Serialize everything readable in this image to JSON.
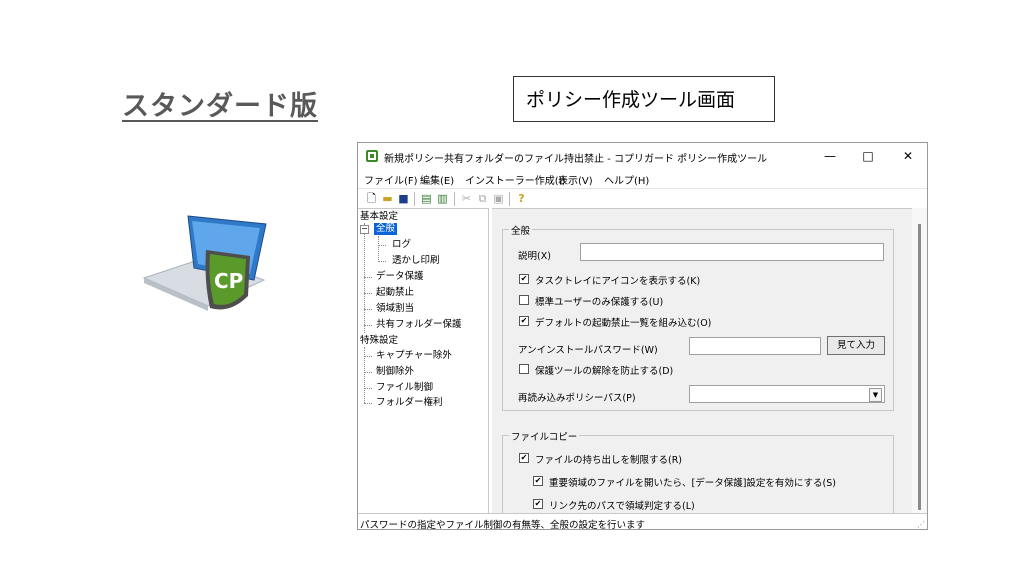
{
  "slide": {
    "title": "スタンダード版",
    "caption": "ポリシー作成ツール画面"
  },
  "logo": {
    "text": "CP",
    "shield_color": "#5a9a2a"
  },
  "window": {
    "title": "新規ポリシー共有フォルダーのファイル持出禁止 - コプリガード ポリシー作成ツール",
    "controls": {
      "minimize": "—",
      "maximize": "□",
      "close": "✕"
    }
  },
  "menu": [
    "ファイル(F)",
    "編集(E)",
    "インストーラー作成(I)",
    "表示(V)",
    "ヘルプ(H)"
  ],
  "toolbar": [
    "new-file-icon",
    "open-folder-icon",
    "save-icon",
    "export-icon",
    "import-icon",
    "cut-icon",
    "copy-icon",
    "paste-icon",
    "help-icon"
  ],
  "tree": {
    "root1": "基本設定",
    "general": "全般",
    "log": "ログ",
    "watermark": "透かし印刷",
    "data_protect": "データ保護",
    "launch_block": "起動禁止",
    "area": "領域割当",
    "shared": "共有フォルダー保護",
    "root2": "特殊設定",
    "capture": "キャプチャー除外",
    "control_ex": "制御除外",
    "file_ctrl": "ファイル制御",
    "folder_auth": "フォルダー権利"
  },
  "general": {
    "group_label": "全般",
    "desc_label": "説明(X)",
    "desc_value": "",
    "tray_icon": "タスクトレイにアイコンを表示する(K)",
    "std_user": "標準ユーザーのみ保護する(U)",
    "default_block": "デフォルトの起動禁止一覧を組み込む(O)",
    "uninstall_pw": "アンインストールパスワード(W)",
    "view_input": "見て入力",
    "prevent_release": "保護ツールの解除を防止する(D)",
    "reload_path": "再読み込みポリシーパス(P)"
  },
  "checks": {
    "tray_icon": true,
    "std_user": false,
    "default_block": true,
    "prevent_release": false,
    "restrict": true,
    "important": true,
    "link": true
  },
  "filecopy": {
    "group_label": "ファイルコピー",
    "restrict": "ファイルの持ち出しを制限する(R)",
    "important": "重要領域のファイルを開いたら、[データ保護]設定を有効にする(S)",
    "link": "リンク先のパスで領域判定する(L)"
  },
  "status": "パスワードの指定やファイル制御の有無等、全般の設定を行います"
}
